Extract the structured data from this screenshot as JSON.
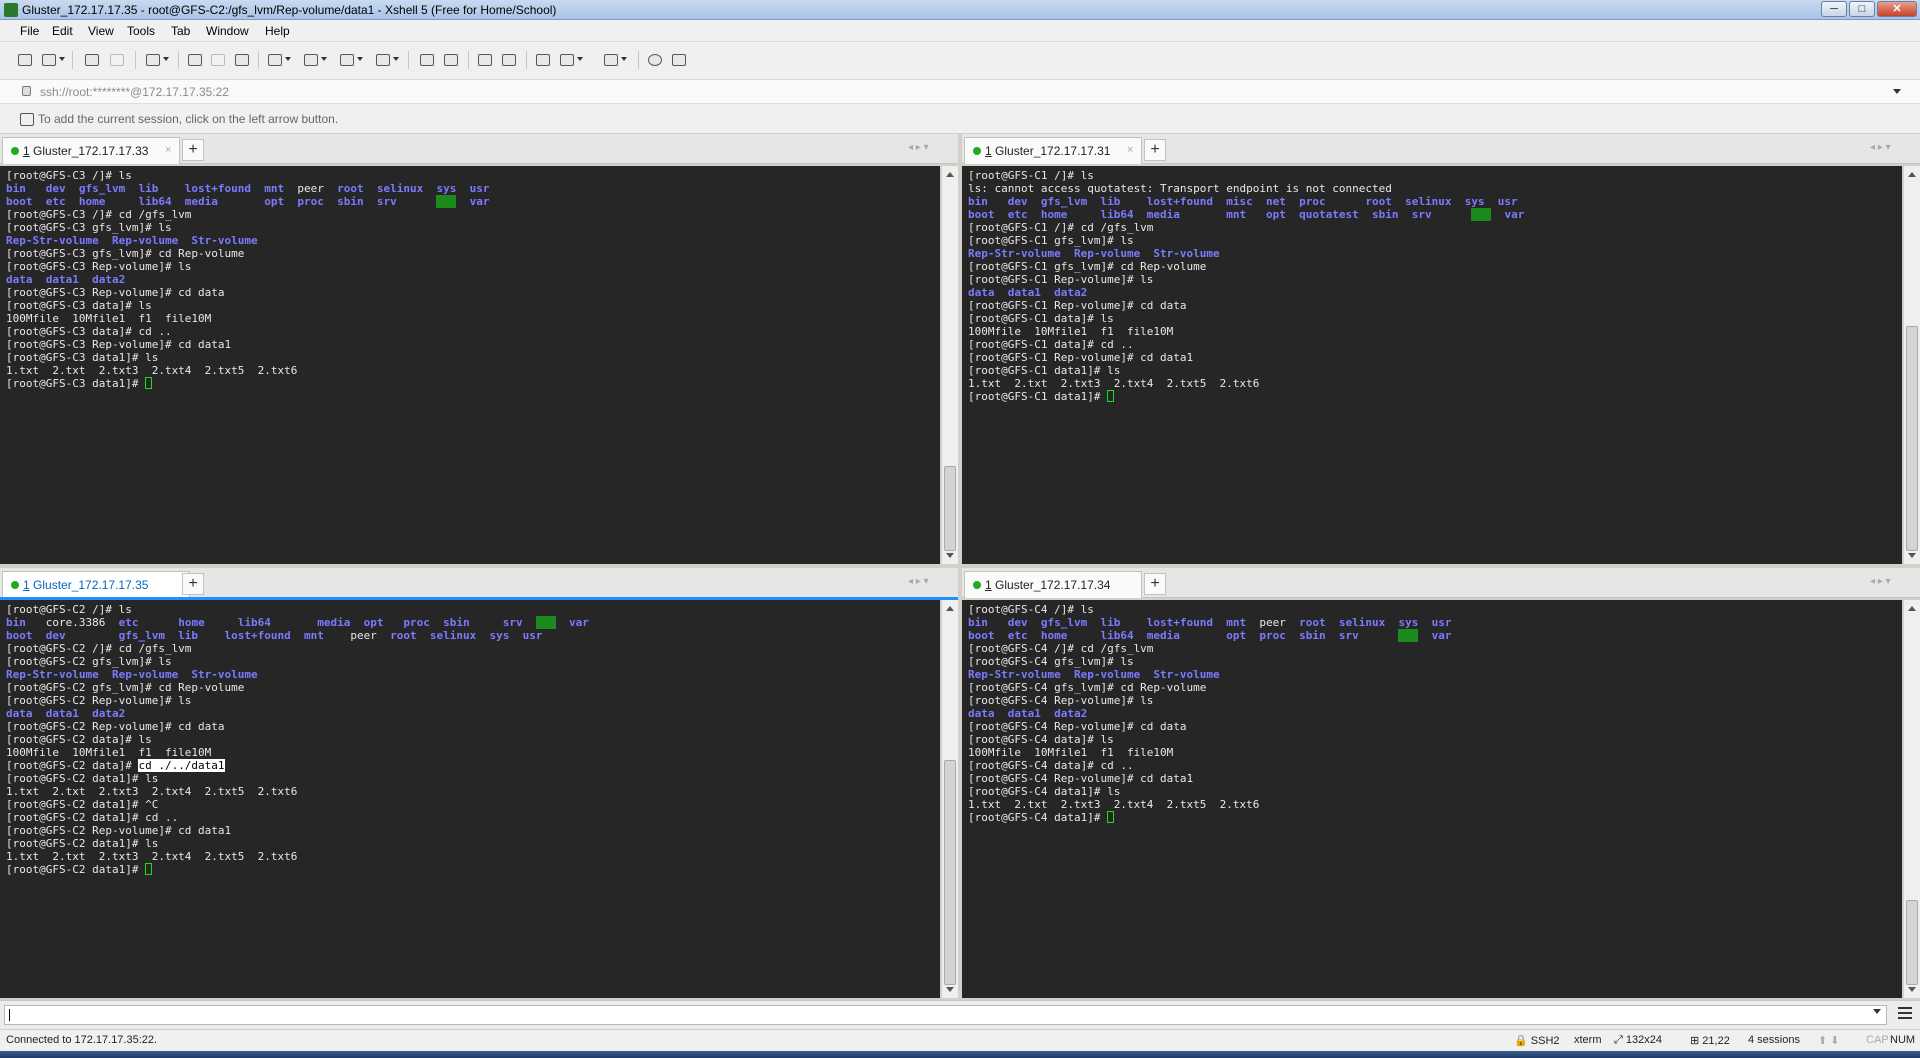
{
  "window": {
    "title": "Gluster_172.17.17.35 - root@GFS-C2:/gfs_lvm/Rep-volume/data1 - Xshell 5 (Free for Home/School)",
    "controls": {
      "minimize": "─",
      "maximize": "□",
      "close": "✕"
    }
  },
  "menu": [
    "File",
    "Edit",
    "View",
    "Tools",
    "Tab",
    "Window",
    "Help"
  ],
  "address": {
    "value": "ssh://root:********@172.17.17.35:22"
  },
  "hint": "To add the current session, click on the left arrow button.",
  "panes": [
    {
      "tab_number": "1",
      "tab_label": " Gluster_172.17.17.33",
      "close": "×",
      "add": "+",
      "nav": "◂ ▸ ▾",
      "lines": [
        [
          [
            "t",
            "[root@GFS-C3 /]# ls"
          ]
        ],
        [
          [
            "b",
            "bin   dev  gfs_lvm  lib    lost+found  mnt  "
          ],
          [
            "t",
            "peer  "
          ],
          [
            "b",
            "root  selinux  sys  usr"
          ]
        ],
        [
          [
            "b",
            "boot  etc  home     lib64  media       opt  proc  sbin  srv      "
          ],
          [
            "h",
            "tmp"
          ],
          [
            "b",
            "  var"
          ]
        ],
        [
          [
            "t",
            "[root@GFS-C3 /]# cd /gfs_lvm"
          ]
        ],
        [
          [
            "t",
            "[root@GFS-C3 gfs_lvm]# ls"
          ]
        ],
        [
          [
            "b",
            "Rep-Str-volume  Rep-volume  Str-volume"
          ]
        ],
        [
          [
            "t",
            "[root@GFS-C3 gfs_lvm]# cd Rep-volume"
          ]
        ],
        [
          [
            "t",
            "[root@GFS-C3 Rep-volume]# ls"
          ]
        ],
        [
          [
            "b",
            "data  data1  data2"
          ]
        ],
        [
          [
            "t",
            "[root@GFS-C3 Rep-volume]# cd data"
          ]
        ],
        [
          [
            "t",
            "[root@GFS-C3 data]# ls"
          ]
        ],
        [
          [
            "t",
            "100Mfile  10Mfile1  f1  file10M"
          ]
        ],
        [
          [
            "t",
            "[root@GFS-C3 data]# cd .."
          ]
        ],
        [
          [
            "t",
            "[root@GFS-C3 Rep-volume]# cd data1"
          ]
        ],
        [
          [
            "t",
            "[root@GFS-C3 data1]# ls"
          ]
        ],
        [
          [
            "t",
            "1.txt  2.txt  2.txt3  2.txt4  2.txt5  2.txt6"
          ]
        ],
        [
          [
            "t",
            "[root@GFS-C3 data1]# "
          ],
          [
            "c",
            ""
          ]
        ]
      ]
    },
    {
      "tab_number": "1",
      "tab_label": " Gluster_172.17.17.31",
      "close": "×",
      "add": "+",
      "nav": "◂ ▸ ▾",
      "lines": [
        [
          [
            "t",
            "[root@GFS-C1 /]# ls"
          ]
        ],
        [
          [
            "t",
            "ls: cannot access quotatest: Transport endpoint is not connected"
          ]
        ],
        [
          [
            "b",
            "bin   dev  gfs_lvm  lib    lost+found  misc  net  proc      root  selinux  sys  usr"
          ]
        ],
        [
          [
            "b",
            "boot  etc  home     lib64  media       mnt   opt  quotatest  sbin  srv      "
          ],
          [
            "h",
            "tmp"
          ],
          [
            "b",
            "  var"
          ]
        ],
        [
          [
            "t",
            "[root@GFS-C1 /]# cd /gfs_lvm"
          ]
        ],
        [
          [
            "t",
            "[root@GFS-C1 gfs_lvm]# ls"
          ]
        ],
        [
          [
            "b",
            "Rep-Str-volume  Rep-volume  Str-volume"
          ]
        ],
        [
          [
            "t",
            "[root@GFS-C1 gfs_lvm]# cd Rep-volume"
          ]
        ],
        [
          [
            "t",
            "[root@GFS-C1 Rep-volume]# ls"
          ]
        ],
        [
          [
            "b",
            "data  data1  data2"
          ]
        ],
        [
          [
            "t",
            "[root@GFS-C1 Rep-volume]# cd data"
          ]
        ],
        [
          [
            "t",
            "[root@GFS-C1 data]# ls"
          ]
        ],
        [
          [
            "t",
            "100Mfile  10Mfile1  f1  file10M"
          ]
        ],
        [
          [
            "t",
            "[root@GFS-C1 data]# cd .."
          ]
        ],
        [
          [
            "t",
            "[root@GFS-C1 Rep-volume]# cd data1"
          ]
        ],
        [
          [
            "t",
            "[root@GFS-C1 data1]# ls"
          ]
        ],
        [
          [
            "t",
            "1.txt  2.txt  2.txt3  2.txt4  2.txt5  2.txt6"
          ]
        ],
        [
          [
            "t",
            "[root@GFS-C1 data1]# "
          ],
          [
            "c",
            ""
          ]
        ]
      ]
    },
    {
      "tab_number": "1",
      "tab_label": " Gluster_172.17.17.35",
      "close": "",
      "add": "+",
      "nav": "◂ ▸ ▾",
      "lines": [
        [
          [
            "t",
            "[root@GFS-C2 /]# ls"
          ]
        ],
        [
          [
            "b",
            "bin   "
          ],
          [
            "t",
            "core.3386  "
          ],
          [
            "b",
            "etc      home     lib64       media  opt   proc  sbin     srv  "
          ],
          [
            "h",
            "tmp"
          ],
          [
            "b",
            "  var"
          ]
        ],
        [
          [
            "b",
            "boot  dev        gfs_lvm  lib    lost+found  mnt    "
          ],
          [
            "t",
            "peer  "
          ],
          [
            "b",
            "root  selinux  sys  usr"
          ]
        ],
        [
          [
            "t",
            "[root@GFS-C2 /]# cd /gfs_lvm"
          ]
        ],
        [
          [
            "t",
            "[root@GFS-C2 gfs_lvm]# ls"
          ]
        ],
        [
          [
            "b",
            "Rep-Str-volume  Rep-volume  Str-volume"
          ]
        ],
        [
          [
            "t",
            "[root@GFS-C2 gfs_lvm]# cd Rep-volume"
          ]
        ],
        [
          [
            "t",
            "[root@GFS-C2 Rep-volume]# ls"
          ]
        ],
        [
          [
            "b",
            "data  data1  data2"
          ]
        ],
        [
          [
            "t",
            "[root@GFS-C2 Rep-volume]# cd data"
          ]
        ],
        [
          [
            "t",
            "[root@GFS-C2 data]# ls"
          ]
        ],
        [
          [
            "t",
            "100Mfile  10Mfile1  f1  file10M"
          ]
        ],
        [
          [
            "t",
            "[root@GFS-C2 data]# "
          ],
          [
            "s",
            "cd ./../data1"
          ]
        ],
        [
          [
            "t",
            "[root@GFS-C2 data1]# ls"
          ]
        ],
        [
          [
            "t",
            "1.txt  2.txt  2.txt3  2.txt4  2.txt5  2.txt6"
          ]
        ],
        [
          [
            "t",
            "[root@GFS-C2 data1]# ^C"
          ]
        ],
        [
          [
            "t",
            "[root@GFS-C2 data1]# cd .."
          ]
        ],
        [
          [
            "t",
            "[root@GFS-C2 Rep-volume]# cd data1"
          ]
        ],
        [
          [
            "t",
            "[root@GFS-C2 data1]# ls"
          ]
        ],
        [
          [
            "t",
            "1.txt  2.txt  2.txt3  2.txt4  2.txt5  2.txt6"
          ]
        ],
        [
          [
            "t",
            "[root@GFS-C2 data1]# "
          ],
          [
            "c",
            ""
          ]
        ]
      ]
    },
    {
      "tab_number": "1",
      "tab_label": " Gluster_172.17.17.34",
      "close": "",
      "add": "+",
      "nav": "◂ ▸ ▾",
      "lines": [
        [
          [
            "t",
            "[root@GFS-C4 /]# ls"
          ]
        ],
        [
          [
            "b",
            "bin   dev  gfs_lvm  lib    lost+found  mnt  "
          ],
          [
            "t",
            "peer  "
          ],
          [
            "b",
            "root  selinux  sys  usr"
          ]
        ],
        [
          [
            "b",
            "boot  etc  home     lib64  media       opt  proc  sbin  srv      "
          ],
          [
            "h",
            "tmp"
          ],
          [
            "b",
            "  var"
          ]
        ],
        [
          [
            "t",
            "[root@GFS-C4 /]# cd /gfs_lvm"
          ]
        ],
        [
          [
            "t",
            "[root@GFS-C4 gfs_lvm]# ls"
          ]
        ],
        [
          [
            "b",
            "Rep-Str-volume  Rep-volume  Str-volume"
          ]
        ],
        [
          [
            "t",
            "[root@GFS-C4 gfs_lvm]# cd Rep-volume"
          ]
        ],
        [
          [
            "t",
            "[root@GFS-C4 Rep-volume]# ls"
          ]
        ],
        [
          [
            "b",
            "data  data1  data2"
          ]
        ],
        [
          [
            "t",
            "[root@GFS-C4 Rep-volume]# cd data"
          ]
        ],
        [
          [
            "t",
            "[root@GFS-C4 data]# ls"
          ]
        ],
        [
          [
            "t",
            "100Mfile  10Mfile1  f1  file10M"
          ]
        ],
        [
          [
            "t",
            "[root@GFS-C4 data]# cd .."
          ]
        ],
        [
          [
            "t",
            "[root@GFS-C4 Rep-volume]# cd data1"
          ]
        ],
        [
          [
            "t",
            "[root@GFS-C4 data1]# ls"
          ]
        ],
        [
          [
            "t",
            "1.txt  2.txt  2.txt3  2.txt4  2.txt5  2.txt6"
          ]
        ],
        [
          [
            "t",
            "[root@GFS-C4 data1]# "
          ],
          [
            "c",
            ""
          ]
        ]
      ]
    }
  ],
  "status": {
    "connection": "Connected to 172.17.17.35:22.",
    "protocol": "SSH2",
    "terminal": "xterm",
    "size": "132x24",
    "cursor": "21,22",
    "sessions": "4 sessions",
    "caps": "CAP",
    "num": "NUM"
  },
  "colors": {
    "terminal_bg": "#262626",
    "dir_blue": "#7b7bff",
    "cursor_green": "#18e018",
    "active_tab_accent": "#1e90ff"
  }
}
